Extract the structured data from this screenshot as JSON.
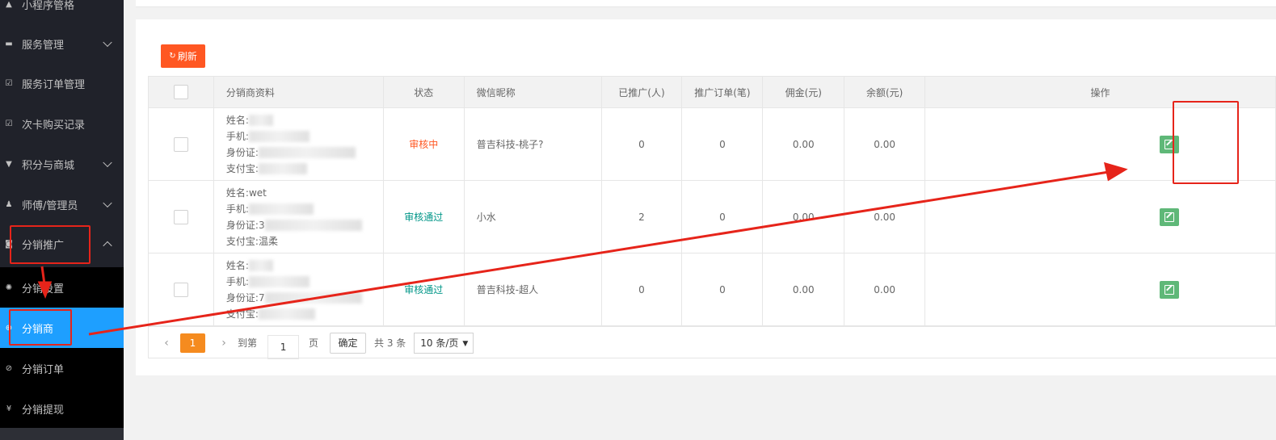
{
  "sidebar": {
    "items": [
      {
        "label": "小程序管格",
        "icon": "sitemap-icon",
        "glyph": "▲",
        "chevron": ""
      },
      {
        "label": "服务管理",
        "icon": "list-icon",
        "glyph": "▬",
        "chevron": "down"
      },
      {
        "label": "服务订单管理",
        "icon": "check-square-icon",
        "glyph": "☑",
        "chevron": ""
      },
      {
        "label": "次卡购买记录",
        "icon": "check-square-icon",
        "glyph": "☑",
        "chevron": ""
      },
      {
        "label": "积分与商城",
        "icon": "cart-icon",
        "glyph": "▼",
        "chevron": "down"
      },
      {
        "label": "师傅/管理员",
        "icon": "user-icon",
        "glyph": "♟",
        "chevron": "down"
      },
      {
        "label": "分销推广",
        "icon": "share-icon",
        "glyph": "◙",
        "chevron": "up"
      }
    ],
    "subitems": [
      {
        "label": "分销设置",
        "icon": "gear-icon",
        "glyph": "✺",
        "active": false
      },
      {
        "label": "分销商",
        "icon": "plus-circle-icon",
        "glyph": "⊕",
        "active": true
      },
      {
        "label": "分销订单",
        "icon": "check-circle-icon",
        "glyph": "⊘",
        "active": false
      },
      {
        "label": "分销提现",
        "icon": "yen-icon",
        "glyph": "¥",
        "active": false
      }
    ]
  },
  "toolbar": {
    "refresh_label": "刷新",
    "refresh_icon": "refresh-icon"
  },
  "table": {
    "headers": [
      "分销商资料",
      "状态",
      "微信昵称",
      "已推广(人)",
      "推广订单(笔)",
      "佣金(元)",
      "余额(元)",
      "操作"
    ],
    "profile_labels": {
      "name": "姓名:",
      "phone": "手机:",
      "id": "身份证:",
      "alipay": "支付宝:"
    },
    "rows": [
      {
        "name": "",
        "phone": "",
        "id_card": "",
        "alipay": "",
        "status": "审核中",
        "status_type": "pending",
        "nickname": "普吉科技-桃子?",
        "promoted": "0",
        "orders": "0",
        "commission": "0.00",
        "balance": "0.00"
      },
      {
        "name": "wet",
        "phone": "",
        "id_card": "3",
        "alipay": "温柔",
        "status": "审核通过",
        "status_type": "pass",
        "nickname": "小水",
        "promoted": "2",
        "orders": "0",
        "commission": "0.00",
        "balance": "0.00"
      },
      {
        "name": "",
        "phone": "",
        "id_card": "7",
        "alipay": "",
        "status": "审核通过",
        "status_type": "pass",
        "nickname": "普吉科技-超人",
        "promoted": "0",
        "orders": "0",
        "commission": "0.00",
        "balance": "0.00"
      }
    ]
  },
  "pagination": {
    "prev": "‹",
    "next": "›",
    "current_page": "1",
    "goto_label": "到第",
    "goto_value": "1",
    "page_unit": "页",
    "confirm_label": "确定",
    "total_label": "共 3 条",
    "page_size_label": "10 条/页",
    "page_size_caret": "▼"
  },
  "colors": {
    "sidebar_bg": "#20222a",
    "active_blue": "#1e9fff",
    "refresh_orange": "#ff5722",
    "edit_green": "#5fb878",
    "annotation_red": "#e6241a"
  }
}
